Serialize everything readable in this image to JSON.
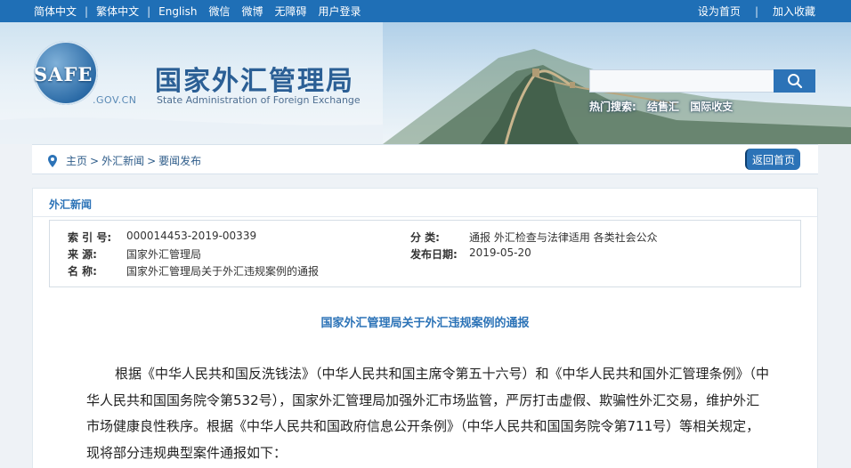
{
  "topbar": {
    "left_links": [
      "简体中文",
      "繁体中文",
      "English"
    ],
    "left_links2": [
      "微信",
      "微博",
      "无障碍",
      "用户登录"
    ],
    "set_home": "设为首页",
    "favorite": "加入收藏"
  },
  "header": {
    "logo_text": "SAFE",
    "logo_domain": ".GOV.CN",
    "title_cn": "国家外汇管理局",
    "title_en": "State Administration of Foreign Exchange",
    "search_placeholder": "",
    "hot_label": "热门搜索:",
    "hot_items": [
      "结售汇",
      "国际收支"
    ]
  },
  "breadcrumb": {
    "items": [
      "主页",
      "外汇新闻",
      "要闻发布"
    ],
    "back_label": "返回首页"
  },
  "section": {
    "title": "外汇新闻"
  },
  "meta": {
    "index_label": "索 引 号:",
    "index_value": "000014453-2019-00339",
    "source_label": "来    源:",
    "source_value": "国家外汇管理局",
    "name_label": "名    称:",
    "name_value": "国家外汇管理局关于外汇违规案例的通报",
    "category_label": "分    类:",
    "category_value": "通报  外汇检查与法律适用  各类社会公众",
    "date_label": "发布日期:",
    "date_value": "2019-05-20"
  },
  "article": {
    "title": "国家外汇管理局关于外汇违规案例的通报",
    "paragraph": "根据《中华人民共和国反洗钱法》（中华人民共和国主席令第五十六号）和《中华人民共和国外汇管理条例》（中华人民共和国国务院令第532号），国家外汇管理局加强外汇市场监管，严厉打击虚假、欺骗性外汇交易，维护外汇市场健康良性秩序。根据《中华人民共和国政府信息公开条例》（中华人民共和国国务院令第711号）等相关规定，现将部分违规典型案件通报如下："
  }
}
